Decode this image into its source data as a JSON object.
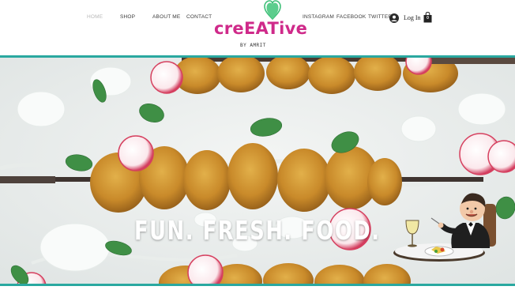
{
  "nav": {
    "items": [
      {
        "label": "HOME",
        "active": true
      },
      {
        "label": "SHOP",
        "active": false
      },
      {
        "label": "ABOUT ME",
        "active": false
      },
      {
        "label": "CONTACT",
        "active": false
      }
    ],
    "social": [
      {
        "label": "INSTAGRAM"
      },
      {
        "label": "FACEBOOK"
      },
      {
        "label": "TWITTER"
      }
    ]
  },
  "logo": {
    "text": "creEATive",
    "byline": "BY AMRIT",
    "icon": "heart-icon",
    "heart_color": "#3fbf78",
    "text_color": "#cf2a8a"
  },
  "account": {
    "login_label": "Log In",
    "avatar_icon": "user-avatar-icon"
  },
  "cart": {
    "icon": "shopping-bag-icon",
    "count": "0"
  },
  "hero": {
    "title": "FUN. FRESH. FOOD.",
    "image": "chicken-skewers-with-radish-and-mint",
    "accent_color": "#2aa8a0"
  },
  "overlay": {
    "icon": "dining-gentleman-icon"
  }
}
